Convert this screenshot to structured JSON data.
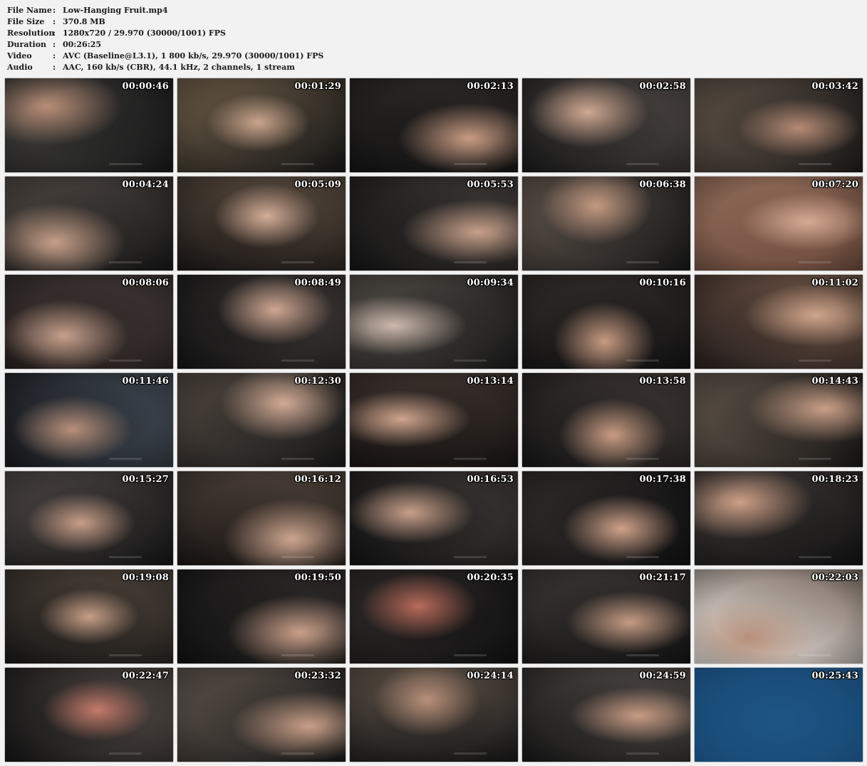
{
  "file_info": [
    {
      "key": "File Name",
      "sep": ":",
      "value": "Low-Hanging Fruit.mp4"
    },
    {
      "key": "File Size",
      "sep": ":",
      "value": "370.8 MB"
    },
    {
      "key": "Resolution",
      "sep": ":",
      "value": "1280x720 / 29.970 (30000/1001) FPS"
    },
    {
      "key": "Duration",
      "sep": ":",
      "value": "00:26:25"
    },
    {
      "key": "Video",
      "sep": ":",
      "value": "AVC (Baseline@L3.1), 1 800 kb/s, 29.970 (30000/1001) FPS"
    },
    {
      "key": "Audio",
      "sep": ":",
      "value": "AAC, 160 kb/s (CBR), 44.1 kHz, 2 channels, 1 stream"
    }
  ],
  "thumbnails": [
    {
      "time": "00:00:46",
      "c1": "#3b3a38",
      "c2": "#b88d76",
      "c3": "#1a1a1a"
    },
    {
      "time": "00:01:29",
      "c1": "#6a5a45",
      "c2": "#caa58d",
      "c3": "#181818"
    },
    {
      "time": "00:02:13",
      "c1": "#2a2624",
      "c2": "#c99c83",
      "c3": "#151515"
    },
    {
      "time": "00:02:58",
      "c1": "#4a4440",
      "c2": "#d0a892",
      "c3": "#1c1c1c"
    },
    {
      "time": "00:03:42",
      "c1": "#5a4e44",
      "c2": "#b58b75",
      "c3": "#201d1b"
    },
    {
      "time": "00:04:24",
      "c1": "#4c4540",
      "c2": "#c69f88",
      "c3": "#191919"
    },
    {
      "time": "00:05:09",
      "c1": "#56483c",
      "c2": "#d5ae98",
      "c3": "#1e1a18"
    },
    {
      "time": "00:05:53",
      "c1": "#3d3835",
      "c2": "#c8a08a",
      "c3": "#161616"
    },
    {
      "time": "00:06:38",
      "c1": "#5b5048",
      "c2": "#c49a82",
      "c3": "#1a1a1a"
    },
    {
      "time": "00:07:20",
      "c1": "#8f6a58",
      "c2": "#d6ab94",
      "c3": "#6e4c3e"
    },
    {
      "time": "00:08:06",
      "c1": "#3a3331",
      "c2": "#c7a08c",
      "c3": "#2a2220"
    },
    {
      "time": "00:08:49",
      "c1": "#3a3432",
      "c2": "#cfa792",
      "c3": "#161616"
    },
    {
      "time": "00:09:34",
      "c1": "#4f4a44",
      "c2": "#cdb9ad",
      "c3": "#1c1c1c"
    },
    {
      "time": "00:10:16",
      "c1": "#2f2a28",
      "c2": "#c89b82",
      "c3": "#141414"
    },
    {
      "time": "00:11:02",
      "c1": "#6c5243",
      "c2": "#d1a68c",
      "c3": "#2a2220"
    },
    {
      "time": "00:11:46",
      "c1": "#3e4650",
      "c2": "#b8907a",
      "c3": "#1a1c20"
    },
    {
      "time": "00:12:30",
      "c1": "#4e453e",
      "c2": "#d2ab95",
      "c3": "#1a1a1a"
    },
    {
      "time": "00:13:14",
      "c1": "#3a302c",
      "c2": "#d0a58e",
      "c3": "#1a1614"
    },
    {
      "time": "00:13:58",
      "c1": "#3c3532",
      "c2": "#c99c82",
      "c3": "#181818"
    },
    {
      "time": "00:14:43",
      "c1": "#5b5046",
      "c2": "#c99f87",
      "c3": "#1c1a18"
    },
    {
      "time": "00:15:27",
      "c1": "#4a4442",
      "c2": "#c89e88",
      "c3": "#171717"
    },
    {
      "time": "00:16:12",
      "c1": "#4c4038",
      "c2": "#cda58f",
      "c3": "#1c1816"
    },
    {
      "time": "00:16:53",
      "c1": "#3a3533",
      "c2": "#c8a08a",
      "c3": "#141414"
    },
    {
      "time": "00:17:38",
      "c1": "#2e2a29",
      "c2": "#d0a28a",
      "c3": "#121212"
    },
    {
      "time": "00:18:23",
      "c1": "#3d3735",
      "c2": "#cd9f86",
      "c3": "#141414"
    },
    {
      "time": "00:19:08",
      "c1": "#4a4038",
      "c2": "#c79f88",
      "c3": "#1c1a18"
    },
    {
      "time": "00:19:50",
      "c1": "#2e2a29",
      "c2": "#caa08a",
      "c3": "#121212"
    },
    {
      "time": "00:20:35",
      "c1": "#2c2827",
      "c2": "#b86a5a",
      "c3": "#121212"
    },
    {
      "time": "00:21:17",
      "c1": "#3a3533",
      "c2": "#c69c84",
      "c3": "#151515"
    },
    {
      "time": "00:22:03",
      "c1": "#7a6a60",
      "c2": "#b8907a",
      "c3": "#ece8e4"
    },
    {
      "time": "00:22:47",
      "c1": "#4c4440",
      "c2": "#c47a6a",
      "c3": "#181818"
    },
    {
      "time": "00:23:32",
      "c1": "#5a5048",
      "c2": "#c99f88",
      "c3": "#1a1a1a"
    },
    {
      "time": "00:24:14",
      "c1": "#5a4e44",
      "c2": "#b8907a",
      "c3": "#1a1a1a"
    },
    {
      "time": "00:24:59",
      "c1": "#4e4844",
      "c2": "#c99c84",
      "c3": "#1a1a1a"
    },
    {
      "time": "00:25:43",
      "c1": "#1a4d7a",
      "c2": "#1d5585",
      "c3": "#16426a"
    }
  ]
}
